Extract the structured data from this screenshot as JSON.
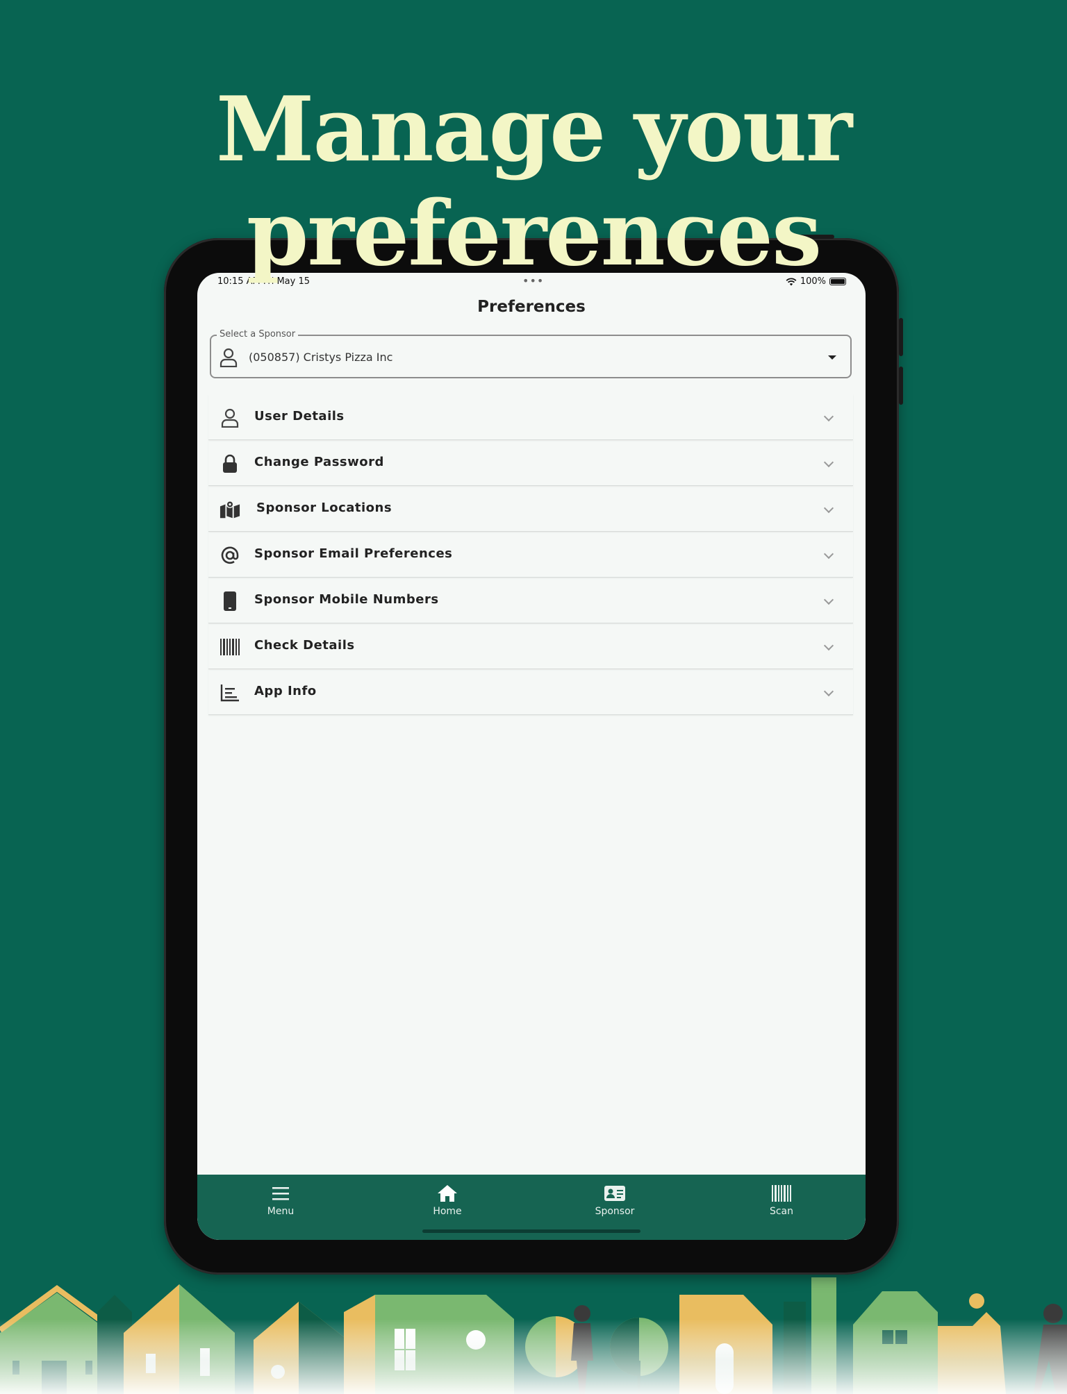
{
  "headline": {
    "line1": "Manage your",
    "line2": "preferences"
  },
  "status_bar": {
    "time": "10:15 AM   Fri May 15",
    "battery": "100%"
  },
  "screen": {
    "title": "Preferences",
    "sponsor_select": {
      "label": "Select a Sponsor",
      "value": "(050857) Cristys Pizza Inc"
    },
    "sections": [
      {
        "label": "User Details",
        "icon": "user-icon"
      },
      {
        "label": "Change Password",
        "icon": "lock-icon"
      },
      {
        "label": "Sponsor Locations",
        "icon": "map-icon"
      },
      {
        "label": "Sponsor Email Preferences",
        "icon": "at-icon"
      },
      {
        "label": "Sponsor Mobile Numbers",
        "icon": "phone-icon"
      },
      {
        "label": "Check Details",
        "icon": "barcode-icon"
      },
      {
        "label": "App Info",
        "icon": "list-chart-icon"
      }
    ]
  },
  "bottom_nav": [
    {
      "label": "Menu",
      "icon": "menu-icon"
    },
    {
      "label": "Home",
      "icon": "home-icon"
    },
    {
      "label": "Sponsor",
      "icon": "id-card-icon"
    },
    {
      "label": "Scan",
      "icon": "barcode-icon"
    }
  ],
  "colors": {
    "background": "#086452",
    "headline": "#f3f6c6",
    "nav": "#166452"
  }
}
